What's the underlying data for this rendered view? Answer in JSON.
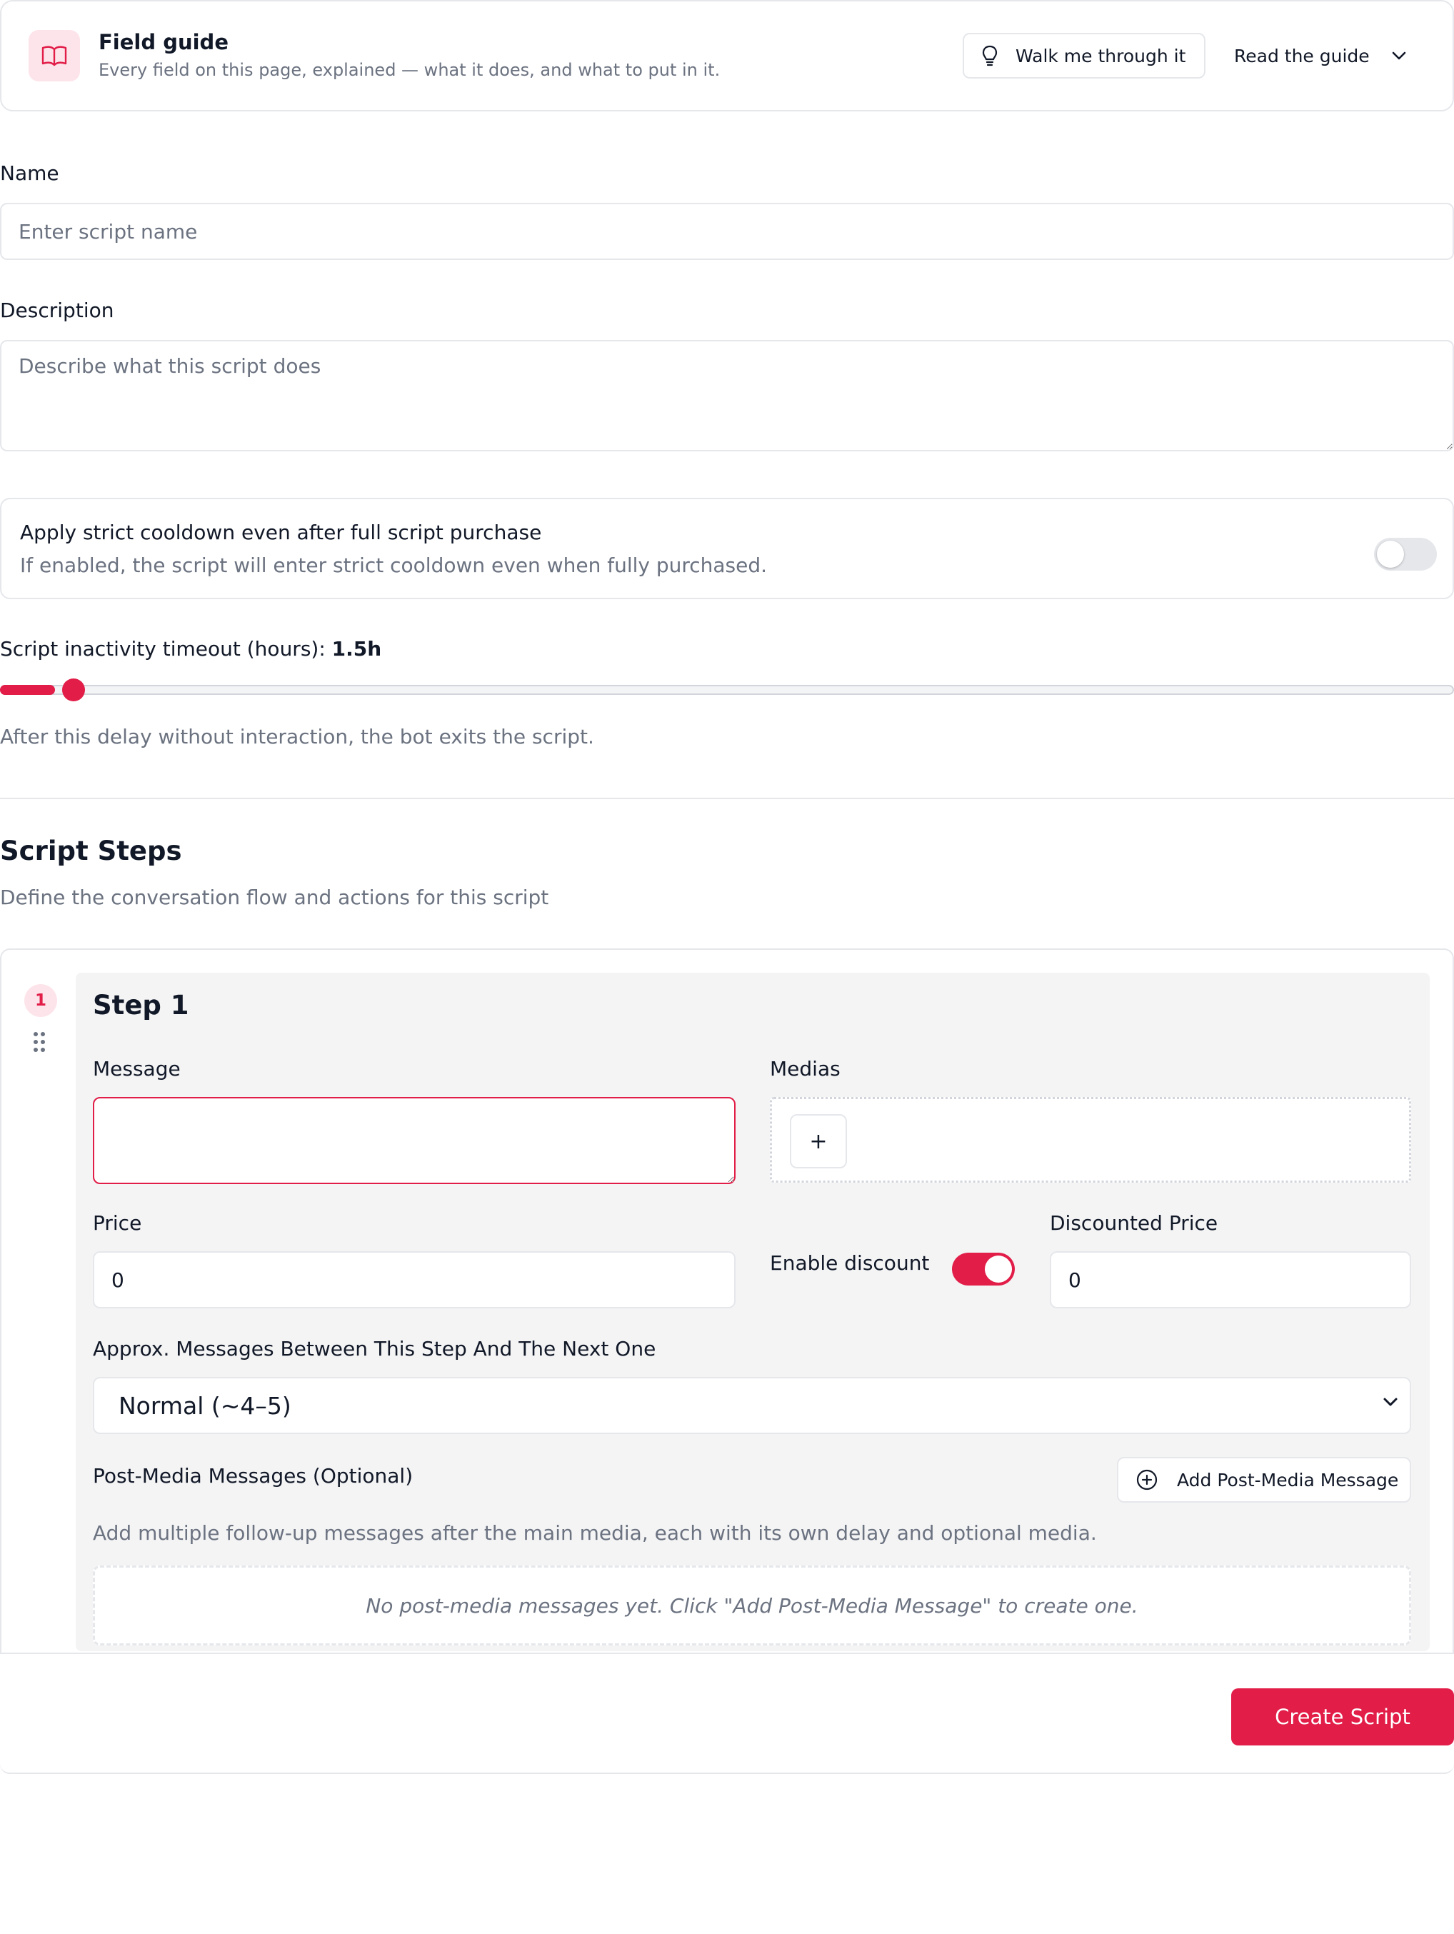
{
  "guide": {
    "title": "Field guide",
    "subtitle": "Every field on this page, explained — what it does, and what to put in it.",
    "walk_label": "Walk me through it",
    "read_label": "Read the guide",
    "icon": "book-open-icon"
  },
  "form": {
    "name_label": "Name",
    "name_placeholder": "Enter script name",
    "description_label": "Description",
    "description_placeholder": "Describe what this script does"
  },
  "cooldown": {
    "title": "Apply strict cooldown even after full script purchase",
    "subtitle": "If enabled, the script will enter strict cooldown even when fully purchased.",
    "enabled": false
  },
  "timeout": {
    "label": "Script inactivity timeout (hours):",
    "value_text": "1.5h",
    "fraction": 0.03,
    "help": "After this delay without interaction, the bot exits the script."
  },
  "steps": {
    "title": "Script Steps",
    "subtitle": "Define the conversation flow and actions for this script",
    "items": [
      {
        "number": "1",
        "title": "Step 1",
        "message_label": "Message",
        "medias_label": "Medias",
        "add_media_glyph": "+",
        "price_label": "Price",
        "price_value": "0",
        "enable_discount_label": "Enable discount",
        "discount_enabled": true,
        "discounted_price_label": "Discounted Price",
        "discounted_price_value": "0",
        "messages_between_label": "Approx. Messages Between This Step And The Next One",
        "messages_between_value": "Normal (~4–5)",
        "post_media_label": "Post-Media Messages (Optional)",
        "add_post_media_label": "Add Post-Media Message",
        "post_media_help": "Add multiple follow-up messages after the main media, each with its own delay and optional media.",
        "post_media_empty": "No post-media messages yet. Click \"Add Post-Media Message\" to create one."
      }
    ]
  },
  "footer": {
    "create_label": "Create Script"
  },
  "colors": {
    "accent": "#e11d48",
    "accent_light": "#fde4ea",
    "border": "#e5e7eb",
    "muted_text": "#6b7280"
  }
}
